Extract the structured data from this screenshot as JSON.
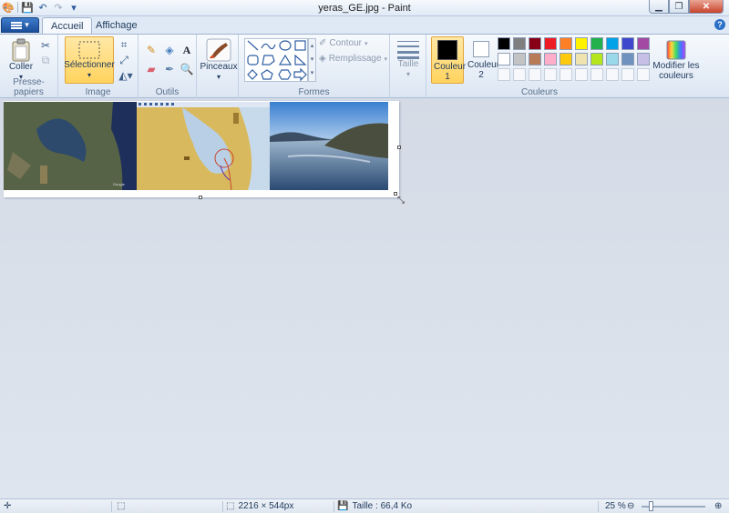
{
  "window": {
    "title": "yeras_GE.jpg - Paint"
  },
  "quick_access": [
    "save-icon",
    "undo-icon",
    "redo-icon",
    "customize-icon"
  ],
  "tabs": [
    {
      "label": "Accueil",
      "active": true
    },
    {
      "label": "Affichage",
      "active": false
    }
  ],
  "ribbon": {
    "clipboard": {
      "paste_label": "Coller",
      "group_label": "Presse-papiers"
    },
    "image": {
      "select_label": "Sélectionner",
      "group_label": "Image"
    },
    "tools": {
      "group_label": "Outils"
    },
    "brushes": {
      "label": "Pinceaux"
    },
    "shapes": {
      "group_label": "Formes",
      "outline_label": "Contour",
      "fill_label": "Remplissage"
    },
    "size": {
      "label": "Taille"
    },
    "colors": {
      "color1_label": "Couleur 1",
      "color2_label": "Couleur 2",
      "group_label": "Couleurs",
      "edit_label": "Modifier les couleurs",
      "color1": "#000000",
      "color2": "#ffffff",
      "palette_row1": [
        "#000000",
        "#7f7f7f",
        "#880015",
        "#ed1c24",
        "#ff7f27",
        "#fff200",
        "#22b14c",
        "#00a2e8",
        "#3f48cc",
        "#a349a4"
      ],
      "palette_row2": [
        "#ffffff",
        "#c3c3c3",
        "#b97a57",
        "#ffaec9",
        "#ffc90e",
        "#efe4b0",
        "#b5e61d",
        "#99d9ea",
        "#7092be",
        "#c8bfe7"
      ]
    }
  },
  "status": {
    "dimensions": "2216 × 544px",
    "size": "Taille : 66,4 Ko",
    "zoom": "25 %"
  }
}
